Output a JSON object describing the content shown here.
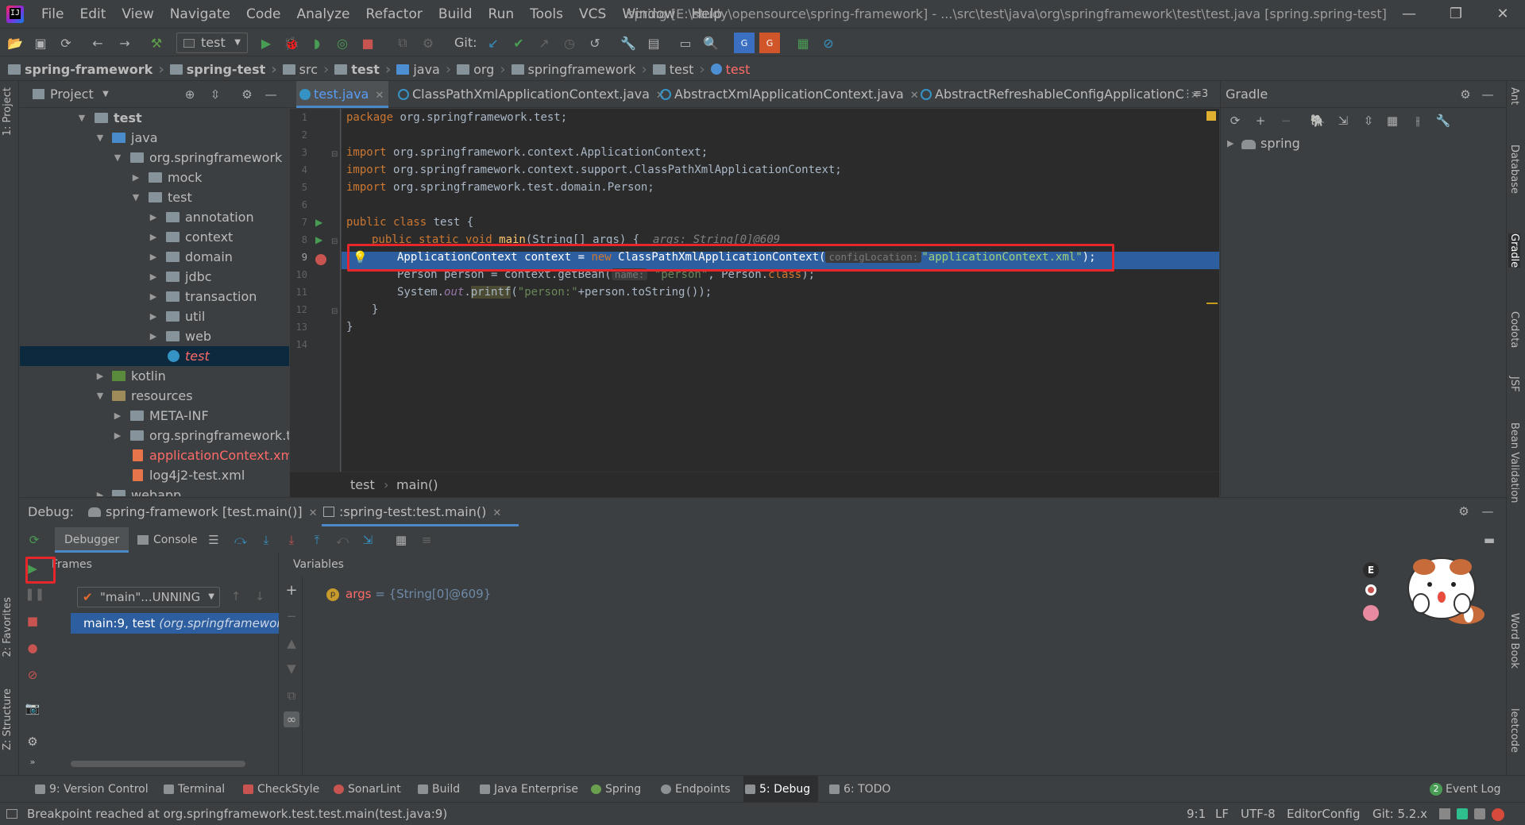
{
  "menubar": {
    "items": [
      "File",
      "Edit",
      "View",
      "Navigate",
      "Code",
      "Analyze",
      "Refactor",
      "Build",
      "Run",
      "Tools",
      "VCS",
      "Window",
      "Help"
    ],
    "title": "spring [E:\\study\\opensource\\spring-framework] - ...\\src\\test\\java\\org\\springframework\\test\\test.java [spring.spring-test]"
  },
  "toolbar": {
    "run_config": "test",
    "git_label": "Git:"
  },
  "breadcrumb": [
    "spring-framework",
    "spring-test",
    "src",
    "test",
    "java",
    "org",
    "springframework",
    "test",
    "test"
  ],
  "left_stripe": {
    "project_tab": "1: Project",
    "favorites_tab": "2: Favorites",
    "structure_tab": "Z: Structure"
  },
  "right_stripe": [
    "Ant",
    "Database",
    "Gradle",
    "Codota",
    "JSF",
    "Bean Validation",
    "Word Book",
    "leetcode"
  ],
  "project": {
    "title": "Project",
    "tree": [
      {
        "label": "test",
        "bold": true
      },
      {
        "label": "java"
      },
      {
        "label": "org.springframework"
      },
      {
        "label": "mock"
      },
      {
        "label": "test"
      },
      {
        "label": "annotation"
      },
      {
        "label": "context"
      },
      {
        "label": "domain"
      },
      {
        "label": "jdbc"
      },
      {
        "label": "transaction"
      },
      {
        "label": "util"
      },
      {
        "label": "web"
      },
      {
        "label": "test"
      },
      {
        "label": "kotlin"
      },
      {
        "label": "resources"
      },
      {
        "label": "META-INF"
      },
      {
        "label": "org.springframework.te"
      },
      {
        "label": "applicationContext.xml"
      },
      {
        "label": "log4j2-test.xml"
      },
      {
        "label": "webapp"
      }
    ]
  },
  "editor": {
    "tabs": [
      "test.java",
      "ClassPathXmlApplicationContext.java",
      "AbstractXmlApplicationContext.java",
      "AbstractRefreshableConfigApplicationC"
    ],
    "tab_overflow": "3",
    "line_numbers": [
      "1",
      "2",
      "3",
      "4",
      "5",
      "6",
      "7",
      "8",
      "9",
      "10",
      "11",
      "12",
      "13",
      "14"
    ],
    "code": {
      "l1_kw": "package",
      "l1_rest": " org.springframework.test;",
      "l3_kw": "import",
      "l3_rest": " org.springframework.context.ApplicationContext;",
      "l4_kw": "import",
      "l4_rest": " org.springframework.context.support.ClassPathXmlApplicationContext;",
      "l5_kw": "import",
      "l5_rest": " org.springframework.test.domain.Person;",
      "l7_kw": "public class",
      "l7_rest": " test {",
      "l8_kw": "public static void",
      "l8_name": " main",
      "l8_args": "(String[] args) {",
      "l8_hint": "args: String[0]@609",
      "l9_a": "ApplicationContext context = ",
      "l9_new": "new",
      "l9_b": " ClassPathXmlApplicationContext(",
      "l9_hint": "configLocation:",
      "l9_str": "\"applicationContext.xml\"",
      "l9_end": ");",
      "l10_a": "Person person = context.getBean(",
      "l10_hint": "name:",
      "l10_str": "\"person\"",
      "l10_b": ", Person.",
      "l10_kw": "class",
      "l10_end": ");",
      "l11_a": "System.",
      "l11_out": "out",
      "l11_b": ".",
      "l11_fn": "printf",
      "l11_c": "(",
      "l11_str": "\"person:\"",
      "l11_end": "+person.toString());",
      "l12": "}",
      "l13": "}"
    },
    "breadcrumb": [
      "test",
      "main()"
    ]
  },
  "gradle": {
    "title": "Gradle",
    "root": "spring"
  },
  "debug": {
    "label": "Debug:",
    "tabs": [
      "spring-framework [test.main()]",
      ":spring-test:test.main()"
    ],
    "subtabs": [
      "Debugger",
      "Console"
    ],
    "frames_title": "Frames",
    "variables_title": "Variables",
    "thread": "\"main\"...UNNING",
    "frame": "main:9, test",
    "frame_pkg": "(org.springframewor",
    "var_name": "args",
    "var_value": " = {String[0]@609}",
    "var_badge": "p"
  },
  "bottombar": {
    "tabs": [
      "9: Version Control",
      "Terminal",
      "CheckStyle",
      "SonarLint",
      "Build",
      "Java Enterprise",
      "Spring",
      "Endpoints",
      "5: Debug",
      "6: TODO"
    ],
    "event_log": "Event Log",
    "event_count": "2"
  },
  "status": {
    "message": "Breakpoint reached at org.springframework.test.test.main(test.java:9)",
    "position": "9:1",
    "line_sep": "LF",
    "encoding": "UTF-8",
    "editorconfig": "EditorConfig",
    "git": "Git: 5.2.x"
  },
  "mascot": {
    "badge": "E"
  },
  "colors": {
    "accent": "#2d5e9f",
    "highlight_box": "#e6262a",
    "keyword": "#cc7832",
    "string": "#6a8759"
  }
}
